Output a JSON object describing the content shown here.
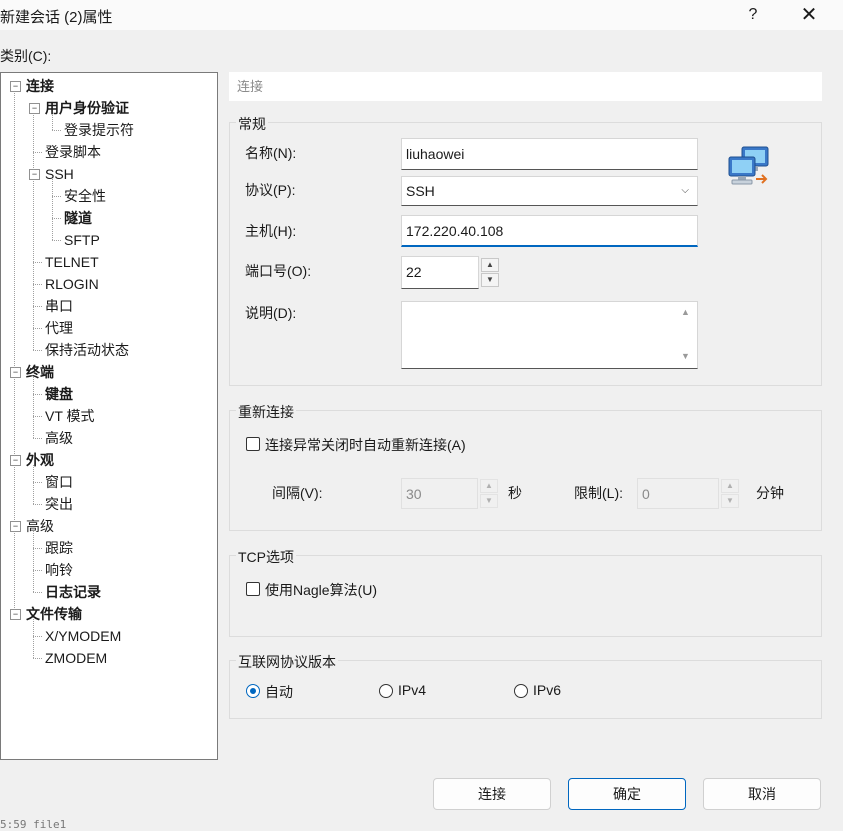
{
  "window": {
    "title": "新建会话 (2)属性",
    "help": "?",
    "close": "✕"
  },
  "category_label": "类别(C):",
  "tree": [
    {
      "label": "连接",
      "bold": true,
      "toggle": "−"
    },
    {
      "label": "用户身份验证",
      "bold": true,
      "toggle": "−"
    },
    {
      "label": "登录提示符",
      "bold": false
    },
    {
      "label": "登录脚本",
      "bold": false
    },
    {
      "label": "SSH",
      "bold": false,
      "toggle": "−"
    },
    {
      "label": "安全性",
      "bold": false
    },
    {
      "label": "隧道",
      "bold": true
    },
    {
      "label": "SFTP",
      "bold": false
    },
    {
      "label": "TELNET",
      "bold": false
    },
    {
      "label": "RLOGIN",
      "bold": false
    },
    {
      "label": "串口",
      "bold": false
    },
    {
      "label": "代理",
      "bold": false
    },
    {
      "label": "保持活动状态",
      "bold": false
    },
    {
      "label": "终端",
      "bold": true,
      "toggle": "−"
    },
    {
      "label": "键盘",
      "bold": true
    },
    {
      "label": "VT 模式",
      "bold": false
    },
    {
      "label": "高级",
      "bold": false
    },
    {
      "label": "外观",
      "bold": true,
      "toggle": "−"
    },
    {
      "label": "窗口",
      "bold": false
    },
    {
      "label": "突出",
      "bold": false
    },
    {
      "label": "高级",
      "bold": false,
      "toggle": "−"
    },
    {
      "label": "跟踪",
      "bold": false
    },
    {
      "label": "响铃",
      "bold": false
    },
    {
      "label": "日志记录",
      "bold": true
    },
    {
      "label": "文件传输",
      "bold": true,
      "toggle": "−"
    },
    {
      "label": "X/YMODEM",
      "bold": false
    },
    {
      "label": "ZMODEM",
      "bold": false
    }
  ],
  "panel_header": "连接",
  "general": {
    "title": "常规",
    "name_label": "名称(N):",
    "name_value": "liuhaowei",
    "protocol_label": "协议(P):",
    "protocol_value": "SSH",
    "host_label": "主机(H):",
    "host_value": "172.220.40.108",
    "port_label": "端口号(O):",
    "port_value": "22",
    "desc_label": "说明(D):",
    "desc_value": ""
  },
  "reconnect": {
    "title": "重新连接",
    "auto_label": "连接异常关闭时自动重新连接(A)",
    "interval_label": "间隔(V):",
    "interval_value": "30",
    "interval_unit": "秒",
    "limit_label": "限制(L):",
    "limit_value": "0",
    "limit_unit": "分钟"
  },
  "tcp": {
    "title": "TCP选项",
    "nagle_label": "使用Nagle算法(U)"
  },
  "ipver": {
    "title": "互联网协议版本",
    "auto": "自动",
    "ipv4": "IPv4",
    "ipv6": "IPv6",
    "selected": "自动"
  },
  "buttons": {
    "connect": "连接",
    "ok": "确定",
    "cancel": "取消"
  },
  "taskbar_text": "5:59 file1",
  "colors": {
    "accent": "#0067c0"
  }
}
